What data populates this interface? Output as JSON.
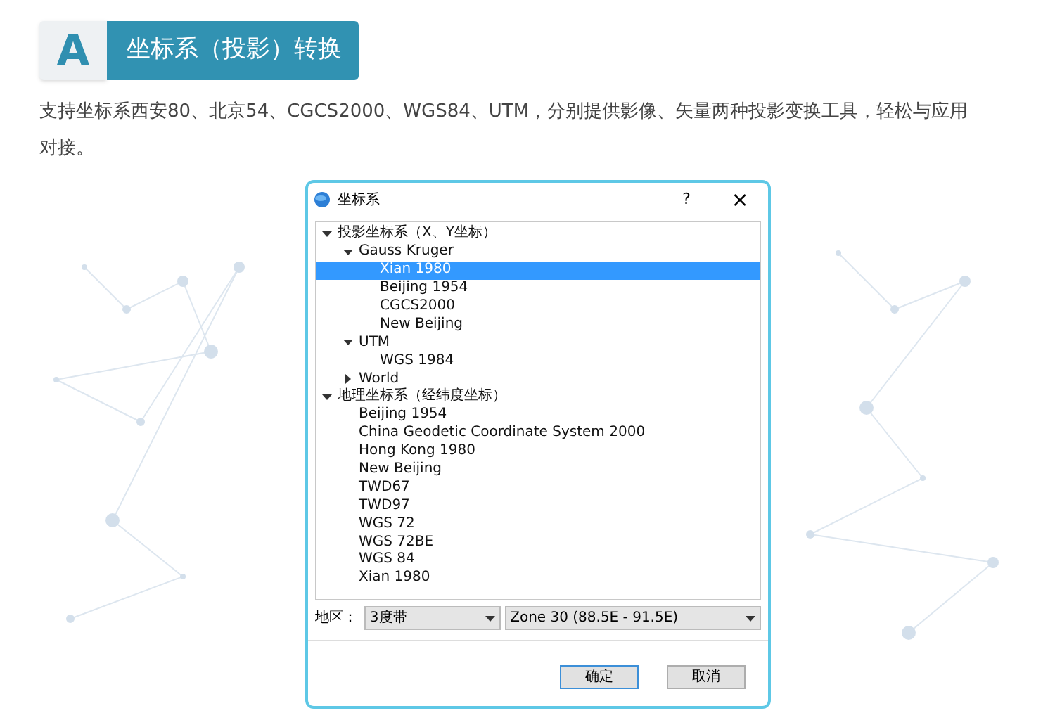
{
  "header": {
    "badge": "A",
    "title": "坐标系（投影）转换"
  },
  "description": "支持坐标系西安80、北京54、CGCS2000、WGS84、UTM，分别提供影像、矢量两种投影变换工具，轻松与应用对接。",
  "background": {
    "kind": "dot_map"
  },
  "dialog": {
    "title": "坐标系",
    "help": "?",
    "close": "×",
    "tree": [
      {
        "label": "投影坐标系（X、Y坐标）",
        "selected": false,
        "expanded": true,
        "children": [
          {
            "label": "Gauss Kruger",
            "selected": false,
            "expanded": true,
            "children": [
              {
                "label": "Xian 1980",
                "selected": true
              },
              {
                "label": "Beijing 1954",
                "selected": false
              },
              {
                "label": "CGCS2000",
                "selected": false
              },
              {
                "label": "New Beijing",
                "selected": false
              }
            ]
          },
          {
            "label": "UTM",
            "selected": false,
            "expanded": true,
            "children": [
              {
                "label": "WGS 1984",
                "selected": false
              }
            ]
          },
          {
            "label": "World",
            "selected": false,
            "expanded": false
          }
        ]
      },
      {
        "label": "地理坐标系（经纬度坐标）",
        "selected": false,
        "expanded": true,
        "children": [
          {
            "label": "Beijing 1954",
            "selected": false
          },
          {
            "label": "China Geodetic Coordinate System 2000",
            "selected": false
          },
          {
            "label": "Hong Kong 1980",
            "selected": false
          },
          {
            "label": "New Beijing",
            "selected": false
          },
          {
            "label": "TWD67",
            "selected": false
          },
          {
            "label": "TWD97",
            "selected": false
          },
          {
            "label": "WGS 72",
            "selected": false
          },
          {
            "label": "WGS 72BE",
            "selected": false
          },
          {
            "label": "WGS 84",
            "selected": false
          },
          {
            "label": "Xian 1980",
            "selected": false
          }
        ]
      }
    ],
    "region_label": "地区：",
    "band_select": "3度带",
    "zone_select": "Zone 30 (88.5E - 91.5E)",
    "buttons": [
      {
        "label": "确定",
        "default": true
      },
      {
        "label": "取消",
        "default": false
      }
    ]
  }
}
